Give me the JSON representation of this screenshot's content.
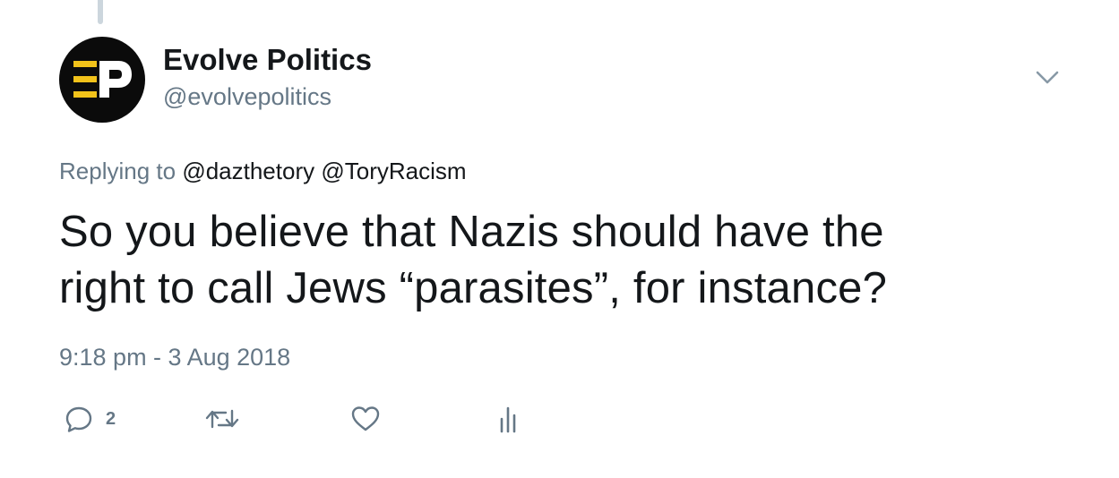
{
  "tweet": {
    "author": {
      "display_name": "Evolve Politics",
      "handle": "@evolvepolitics",
      "avatar_text": "EP"
    },
    "reply_context": {
      "prefix": "Replying to",
      "mentions": [
        "@dazthetory",
        "@ToryRacism"
      ]
    },
    "text_line1": "So you believe that Nazis should have the",
    "text_line2": "right to call Jews “parasites”, for instance?",
    "timestamp": "9:18 pm - 3 Aug 2018",
    "actions": {
      "reply": {
        "icon": "reply-icon",
        "count": "2"
      },
      "retweet": {
        "icon": "retweet-icon"
      },
      "like": {
        "icon": "heart-icon"
      },
      "analytics": {
        "icon": "analytics-icon"
      }
    },
    "menu_icon": "chevron-down-icon"
  },
  "colors": {
    "text": "#14171a",
    "secondary": "#657786",
    "thread_line": "#ccd6dd",
    "logo_yellow": "#f2c21a"
  }
}
